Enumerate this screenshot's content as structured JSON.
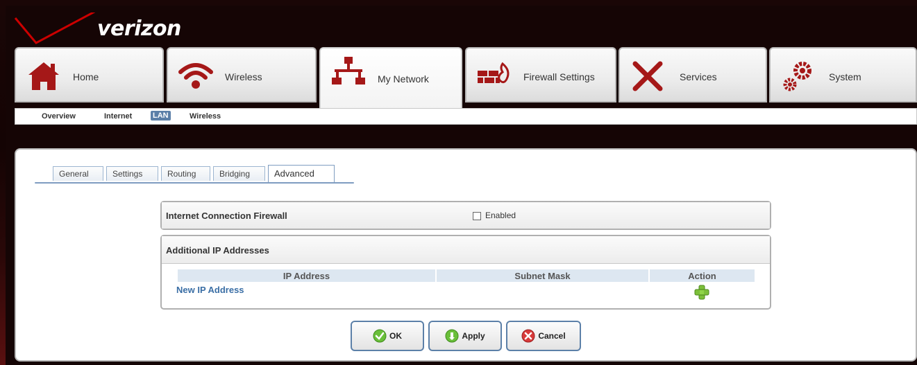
{
  "brand": {
    "logo_text": "verizon",
    "accent_color": "#cc0000"
  },
  "topnav": {
    "tabs": [
      {
        "label": "Home",
        "icon": "home-icon"
      },
      {
        "label": "Wireless",
        "icon": "wifi-icon"
      },
      {
        "label": "My Network",
        "icon": "network-icon",
        "active": true
      },
      {
        "label": "Firewall Settings",
        "icon": "firewall-icon"
      },
      {
        "label": "Services",
        "icon": "tools-icon"
      },
      {
        "label": "System",
        "icon": "gears-icon"
      }
    ]
  },
  "subnav": {
    "items": [
      {
        "label": "Overview"
      },
      {
        "label": "Internet"
      },
      {
        "label": "LAN",
        "selected": true
      },
      {
        "label": "Wireless"
      }
    ]
  },
  "subtabs": {
    "items": [
      {
        "label": "General"
      },
      {
        "label": "Settings"
      },
      {
        "label": "Routing"
      },
      {
        "label": "Bridging"
      },
      {
        "label": "Advanced",
        "active": true
      }
    ]
  },
  "firewall_section": {
    "title": "Internet Connection Firewall",
    "checkbox_label": "Enabled",
    "checked": false
  },
  "ip_section": {
    "title": "Additional IP Addresses",
    "columns": [
      "IP Address",
      "Subnet Mask",
      "Action"
    ],
    "new_link": "New IP Address",
    "add_icon": "add-icon"
  },
  "buttons": {
    "ok": "OK",
    "apply": "Apply",
    "cancel": "Cancel"
  }
}
